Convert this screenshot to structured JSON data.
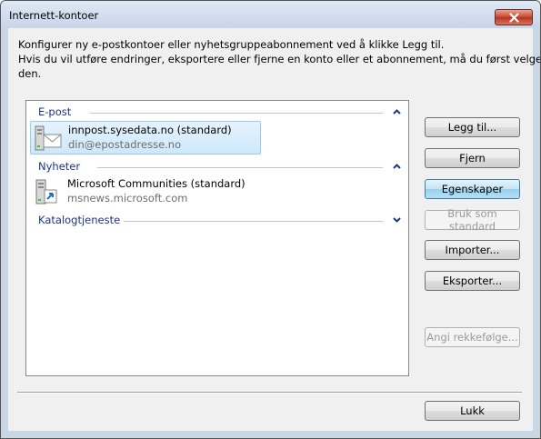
{
  "window": {
    "title": "Internett-kontoer"
  },
  "intro": {
    "line1": "Konfigurer ny e-postkontoer eller nyhetsgruppeabonnement ved å klikke Legg til.",
    "line2": "Hvis du vil utføre endringer, eksportere eller fjerne en konto eller et abonnement, må du først velge",
    "line3": "den."
  },
  "groups": [
    {
      "label": "E-post",
      "state": "expanded"
    },
    {
      "label": "Nyheter",
      "state": "expanded"
    },
    {
      "label": "Katalogtjeneste",
      "state": "collapsed"
    }
  ],
  "accounts": [
    {
      "name": "innpost.sysedata.no (standard)",
      "detail": "din@epostadresse.no",
      "icon": "mail-server-icon",
      "selected": true
    },
    {
      "name": "Microsoft Communities (standard)",
      "detail": "msnews.microsoft.com",
      "icon": "news-server-icon",
      "selected": false
    }
  ],
  "buttons": {
    "add": "Legg til...",
    "remove": "Fjern",
    "properties": "Egenskaper",
    "set_default": "Bruk som standard",
    "import": "Importer...",
    "export": "Eksporter...",
    "set_order": "Angi rekkefølge...",
    "close": "Lukk"
  },
  "colors": {
    "group_label": "#1e3287",
    "selection": "#cde8fb"
  }
}
